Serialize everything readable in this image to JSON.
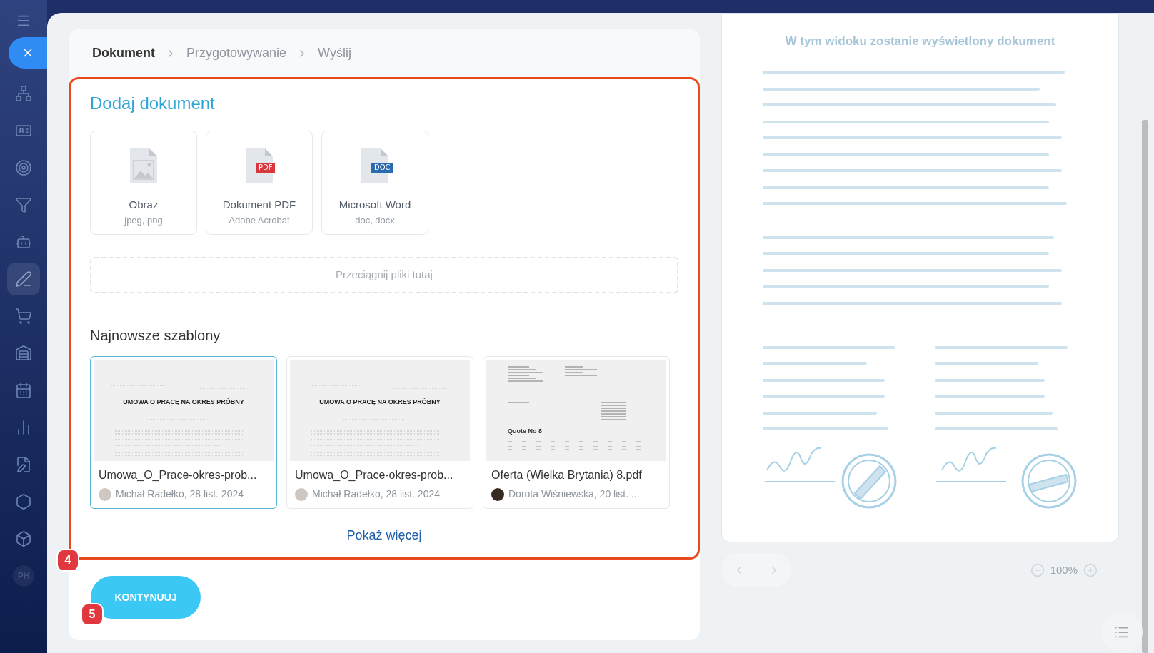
{
  "sidebar": {
    "items": [
      {
        "selected": false
      },
      {
        "selected": false
      },
      {
        "selected": false
      },
      {
        "selected": false
      },
      {
        "selected": false
      },
      {
        "selected": true
      },
      {
        "selected": false
      },
      {
        "selected": false
      },
      {
        "selected": false
      },
      {
        "selected": false
      },
      {
        "selected": false
      },
      {
        "selected": false
      },
      {
        "selected": false
      },
      {
        "label": "PH",
        "selected": false
      }
    ]
  },
  "breadcrumb": [
    {
      "label": "Dokument",
      "selected": true
    },
    {
      "label": "Przygotowywanie",
      "selected": false
    },
    {
      "label": "Wyślij",
      "selected": false
    }
  ],
  "section_title": "Dodaj dokument",
  "file_types": [
    {
      "kind": "image",
      "title": "Obraz",
      "subtitle": "jpeg, png"
    },
    {
      "kind": "pdf",
      "title": "Dokument PDF",
      "subtitle": "Adobe Acrobat",
      "badge": "PDF"
    },
    {
      "kind": "doc",
      "title": "Microsoft Word",
      "subtitle": "doc, docx",
      "badge": "DOC"
    }
  ],
  "dropzone": {
    "placeholder": "Przeciągnij pliki tutaj"
  },
  "templates_title": "Najnowsze szablony",
  "templates": [
    {
      "kind": "contract",
      "heading": "UMOWA O PRACĘ NA OKRES PRÓBNY",
      "name": "Umowa_O_Prace-okres-prob...",
      "author": "Michał Radełko, 28 list. 2024",
      "selected": true
    },
    {
      "kind": "contract",
      "heading": "UMOWA O PRACĘ NA OKRES PRÓBNY",
      "name": "Umowa_O_Prace-okres-prob...",
      "author": "Michał Radełko, 28 list. 2024",
      "selected": false
    },
    {
      "kind": "quote",
      "heading": "Quote No 8",
      "name": "Oferta (Wielka Brytania) 8.pdf",
      "author": "Dorota Wiśniewska, 20 list. ...",
      "selected": false
    }
  ],
  "show_more": "Pokaż więcej",
  "continue_button": "KONTYNUUJ",
  "step_badges": [
    "4",
    "5"
  ],
  "preview": {
    "title": "W tym widoku zostanie wyświetlony dokument",
    "zoom": "100%"
  }
}
